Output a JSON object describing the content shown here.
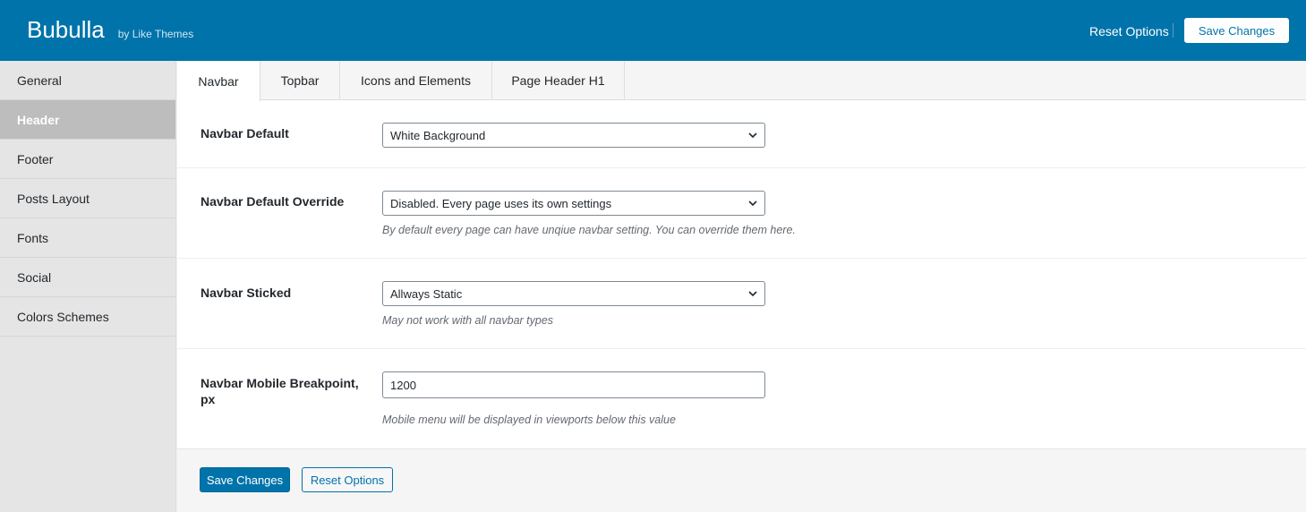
{
  "header": {
    "title": "Bubulla",
    "byline": "by Like Themes",
    "reset_label": "Reset Options",
    "save_label": "Save Changes"
  },
  "sidebar": {
    "items": [
      {
        "label": "General"
      },
      {
        "label": "Header"
      },
      {
        "label": "Footer"
      },
      {
        "label": "Posts Layout"
      },
      {
        "label": "Fonts"
      },
      {
        "label": "Social"
      },
      {
        "label": "Colors Schemes"
      }
    ],
    "active": "Header"
  },
  "tabs": [
    {
      "label": "Navbar"
    },
    {
      "label": "Topbar"
    },
    {
      "label": "Icons and Elements"
    },
    {
      "label": "Page Header H1"
    }
  ],
  "active_tab": "Navbar",
  "settings": {
    "navbar_default": {
      "label": "Navbar Default",
      "value": "White Background"
    },
    "navbar_override": {
      "label": "Navbar Default Override",
      "value": "Disabled. Every page uses its own settings",
      "description": "By default every page can have unqiue navbar setting. You can override them here."
    },
    "navbar_sticked": {
      "label": "Navbar Sticked",
      "value": "Allways Static",
      "description": "May not work with all navbar types"
    },
    "navbar_breakpoint": {
      "label_line1": "Navbar Mobile Breakpoint,",
      "label_line2": "px",
      "value": "1200",
      "description": "Mobile menu will be displayed in viewports below this value"
    }
  },
  "footer": {
    "save_label": "Save Changes",
    "reset_label": "Reset Options"
  },
  "colors": {
    "accent": "#0073aa",
    "sidebar_active": "#bdbdbd"
  }
}
